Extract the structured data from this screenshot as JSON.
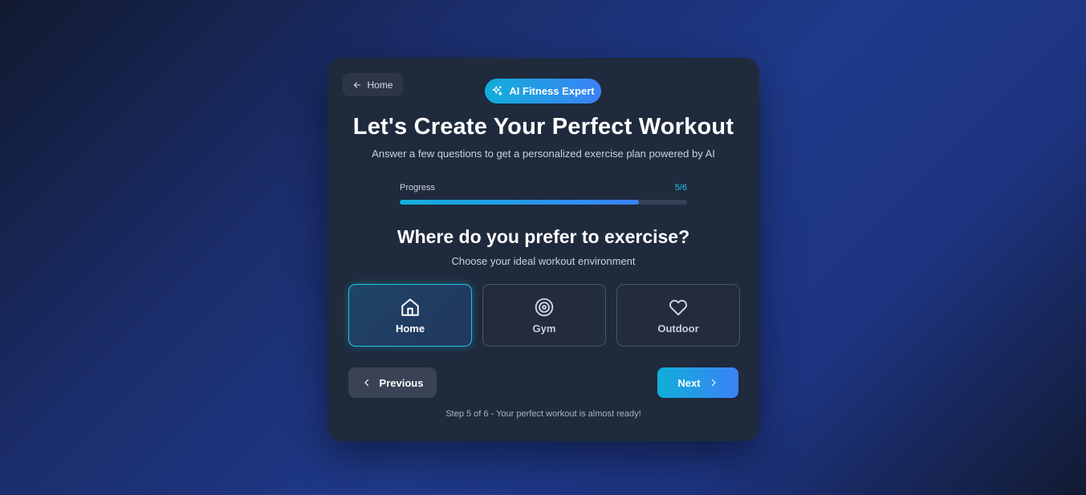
{
  "nav": {
    "home_label": "Home",
    "home_icon": "arrow-left-icon"
  },
  "badge": {
    "label": "AI Fitness Expert",
    "icon": "sparkles-icon"
  },
  "header": {
    "title": "Let's Create Your Perfect Workout",
    "subtitle": "Answer a few questions to get a personalized exercise plan powered by AI"
  },
  "progress": {
    "label": "Progress",
    "count": "5/6",
    "value": 0.833
  },
  "question": {
    "title": "Where do you prefer to exercise?",
    "subtitle": "Choose your ideal workout environment"
  },
  "options": [
    {
      "label": "Home",
      "icon": "home-icon",
      "selected": true
    },
    {
      "label": "Gym",
      "icon": "target-icon",
      "selected": false
    },
    {
      "label": "Outdoor",
      "icon": "heart-icon",
      "selected": false
    }
  ],
  "buttons": {
    "previous_label": "Previous",
    "next_label": "Next"
  },
  "footer": {
    "text": "Step 5 of 6 - Your perfect workout is almost ready!"
  },
  "colors": {
    "accent": "#22c3e6",
    "gradient_start": "#11aed8",
    "gradient_end": "#3b82f6",
    "card": "#1f2a3d"
  }
}
